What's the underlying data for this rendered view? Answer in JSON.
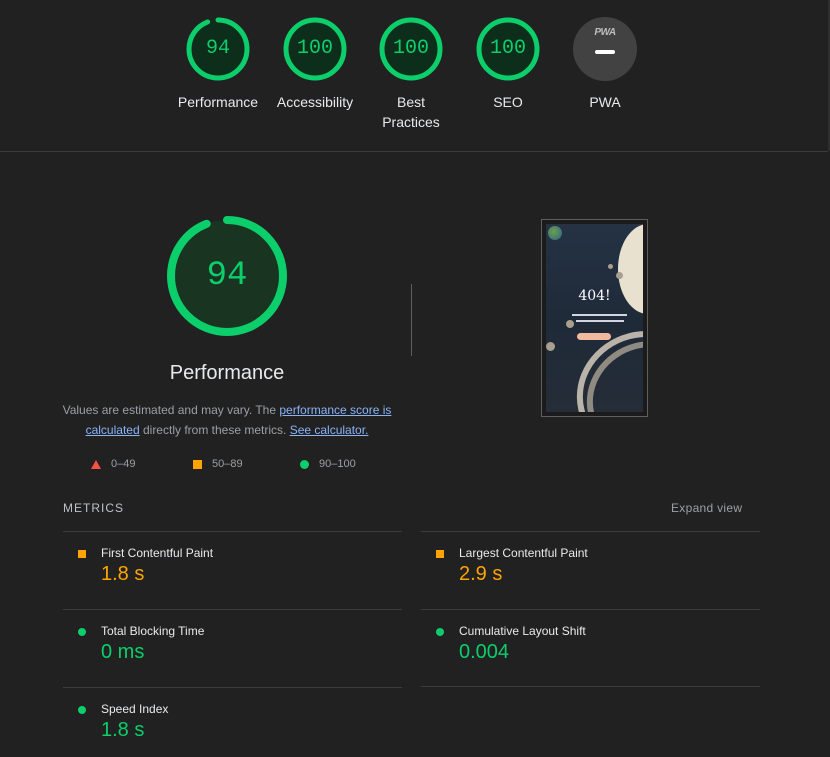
{
  "categories": [
    {
      "label": "94",
      "name": "Performance",
      "lines": [
        "Performance"
      ],
      "score": 94
    },
    {
      "label": "100",
      "name": "Accessibility",
      "lines": [
        "Accessibility"
      ],
      "score": 100
    },
    {
      "label": "100",
      "name": "Best Practices",
      "lines": [
        "Best",
        "Practices"
      ],
      "score": 100
    },
    {
      "label": "100",
      "name": "SEO",
      "lines": [
        "SEO"
      ],
      "score": 100
    }
  ],
  "pwa": {
    "badge": "PWA",
    "label": "PWA"
  },
  "main": {
    "score": "94",
    "score_value": 94,
    "title": "Performance",
    "desc_prefix": "Values are estimated and may vary. The ",
    "desc_link1": "performance score is calculated",
    "desc_middle": " directly from these metrics. ",
    "desc_link2": "See calculator."
  },
  "legend": {
    "fail": "0–49",
    "average": "50–89",
    "pass": "90–100"
  },
  "screenshot": {
    "heading": "404!"
  },
  "metrics": {
    "header": "METRICS",
    "expand": "Expand view",
    "fcp": {
      "name": "First Contentful Paint",
      "value": "1.8 s",
      "status": "average"
    },
    "lcp": {
      "name": "Largest Contentful Paint",
      "value": "2.9 s",
      "status": "average"
    },
    "tbt": {
      "name": "Total Blocking Time",
      "value": "0 ms",
      "status": "pass"
    },
    "cls": {
      "name": "Cumulative Layout Shift",
      "value": "0.004",
      "status": "pass"
    },
    "si": {
      "name": "Speed Index",
      "value": "1.8 s",
      "status": "pass"
    }
  },
  "colors": {
    "pass": "#0cce6b",
    "average": "#ffa400",
    "fail": "#ff4e42",
    "background": "#212121",
    "link": "#8ab4f8"
  }
}
